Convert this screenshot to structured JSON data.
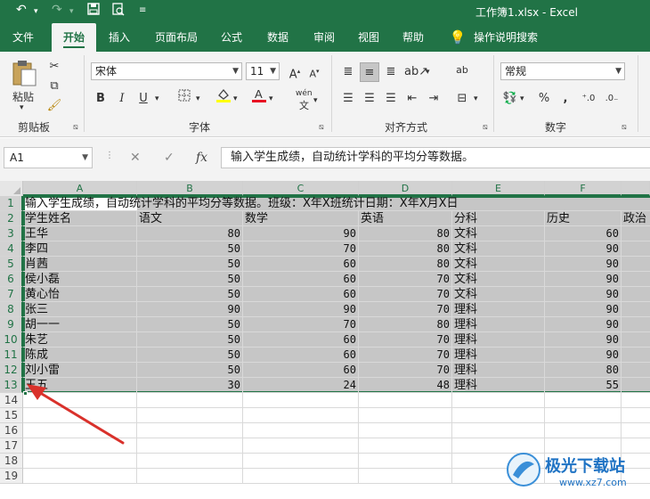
{
  "titlebar": {
    "undo_icon": "undo-icon",
    "redo_icon": "redo-icon",
    "title": "工作簿1.xlsx  -  Excel"
  },
  "tabs": [
    "文件",
    "开始",
    "插入",
    "页面布局",
    "公式",
    "数据",
    "审阅",
    "视图",
    "帮助",
    "操作说明搜索"
  ],
  "ribbon": {
    "paste_label": "粘贴",
    "clipboard_label": "剪贴板",
    "font_name": "宋体",
    "font_size": "11",
    "font_label": "字体",
    "bold": "B",
    "italic": "I",
    "underline": "U",
    "align_label": "对齐方式",
    "number_format": "常规",
    "number_label": "数字",
    "wen_label": "wén",
    "ab_label": "ab"
  },
  "formula_bar": {
    "name_box": "A1",
    "fx": "fx",
    "content": "输入学生成绩，自动统计学科的平均分等数据。"
  },
  "columns": [
    "A",
    "B",
    "C",
    "D",
    "E",
    "F"
  ],
  "rows": [
    "1",
    "2",
    "3",
    "4",
    "5",
    "6",
    "7",
    "8",
    "9",
    "10",
    "11",
    "12",
    "13",
    "14",
    "15",
    "16",
    "17",
    "18",
    "19"
  ],
  "sheet": {
    "row1_text": "输入学生成绩，自动统计学科的平均分等数据。班级：X年X班统计日期：X年X月X日",
    "headers": [
      "学生姓名",
      "语文",
      "数学",
      "英语",
      "分科",
      "历史",
      "政治"
    ],
    "data": [
      [
        "王华",
        "80",
        "90",
        "80",
        "文科",
        "60"
      ],
      [
        "李四",
        "50",
        "70",
        "80",
        "文科",
        "90"
      ],
      [
        "肖茜",
        "50",
        "60",
        "80",
        "文科",
        "90"
      ],
      [
        "侯小磊",
        "50",
        "60",
        "70",
        "文科",
        "90"
      ],
      [
        "黄心怡",
        "50",
        "60",
        "70",
        "文科",
        "90"
      ],
      [
        "张三",
        "90",
        "90",
        "70",
        "理科",
        "90"
      ],
      [
        "胡一一",
        "50",
        "70",
        "80",
        "理科",
        "90"
      ],
      [
        "朱艺",
        "50",
        "60",
        "70",
        "理科",
        "90"
      ],
      [
        "陈成",
        "50",
        "60",
        "70",
        "理科",
        "90"
      ],
      [
        "刘小雷",
        "50",
        "60",
        "70",
        "理科",
        "80"
      ],
      [
        "王五",
        "30",
        "24",
        "48",
        "理科",
        "55"
      ]
    ]
  },
  "watermark": {
    "brand": "极光下载站",
    "url": "www.xz7.com"
  },
  "colors": {
    "excel_green": "#217346",
    "selection": "#217346",
    "arrow": "#d9312b"
  }
}
